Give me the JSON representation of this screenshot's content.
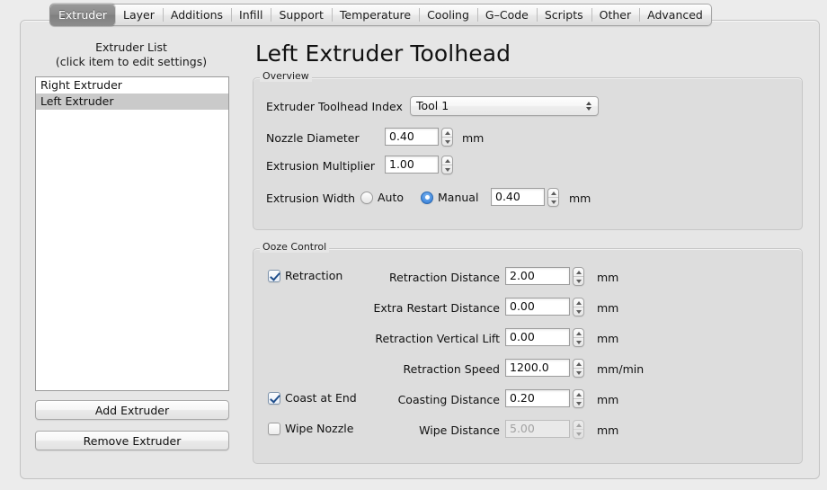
{
  "tabs": [
    {
      "label": "Extruder",
      "active": true
    },
    {
      "label": "Layer",
      "active": false
    },
    {
      "label": "Additions",
      "active": false
    },
    {
      "label": "Infill",
      "active": false
    },
    {
      "label": "Support",
      "active": false
    },
    {
      "label": "Temperature",
      "active": false
    },
    {
      "label": "Cooling",
      "active": false
    },
    {
      "label": "G–Code",
      "active": false
    },
    {
      "label": "Scripts",
      "active": false
    },
    {
      "label": "Other",
      "active": false
    },
    {
      "label": "Advanced",
      "active": false
    }
  ],
  "sidebar": {
    "title": "Extruder List",
    "subtitle": "(click item to edit settings)",
    "items": [
      {
        "label": "Right Extruder",
        "selected": false
      },
      {
        "label": "Left Extruder",
        "selected": true
      }
    ],
    "add_button": "Add Extruder",
    "remove_button": "Remove Extruder"
  },
  "page_title": "Left Extruder Toolhead",
  "overview": {
    "group_label": "Overview",
    "toolhead_index": {
      "label": "Extruder Toolhead Index",
      "value": "Tool 1"
    },
    "nozzle_diameter": {
      "label": "Nozzle Diameter",
      "value": "0.40",
      "unit": "mm"
    },
    "extrusion_multiplier": {
      "label": "Extrusion Multiplier",
      "value": "1.00",
      "unit": ""
    },
    "extrusion_width": {
      "label": "Extrusion Width",
      "auto_label": "Auto",
      "manual_label": "Manual",
      "selected": "Manual",
      "value": "0.40",
      "unit": "mm"
    }
  },
  "ooze_control": {
    "group_label": "Ooze Control",
    "retraction": {
      "label": "Retraction",
      "checked": true
    },
    "coast_at_end": {
      "label": "Coast at End",
      "checked": true
    },
    "wipe_nozzle": {
      "label": "Wipe Nozzle",
      "checked": false
    },
    "fields": [
      {
        "label": "Retraction Distance",
        "value": "2.00",
        "unit": "mm",
        "disabled": false
      },
      {
        "label": "Extra Restart Distance",
        "value": "0.00",
        "unit": "mm",
        "disabled": false
      },
      {
        "label": "Retraction Vertical Lift",
        "value": "0.00",
        "unit": "mm",
        "disabled": false
      },
      {
        "label": "Retraction Speed",
        "value": "1200.0",
        "unit": "mm/min",
        "disabled": false
      },
      {
        "label": "Coasting Distance",
        "value": "0.20",
        "unit": "mm",
        "disabled": false
      },
      {
        "label": "Wipe Distance",
        "value": "5.00",
        "unit": "mm",
        "disabled": true
      }
    ]
  },
  "colors": {
    "window_bg": "#ececec",
    "panel_bg": "#e6e6e6",
    "group_bg": "#dddddd",
    "accent_blue": "#4a90e2",
    "selection_gray": "#cacaca",
    "active_tab": "#8a8a8a"
  }
}
